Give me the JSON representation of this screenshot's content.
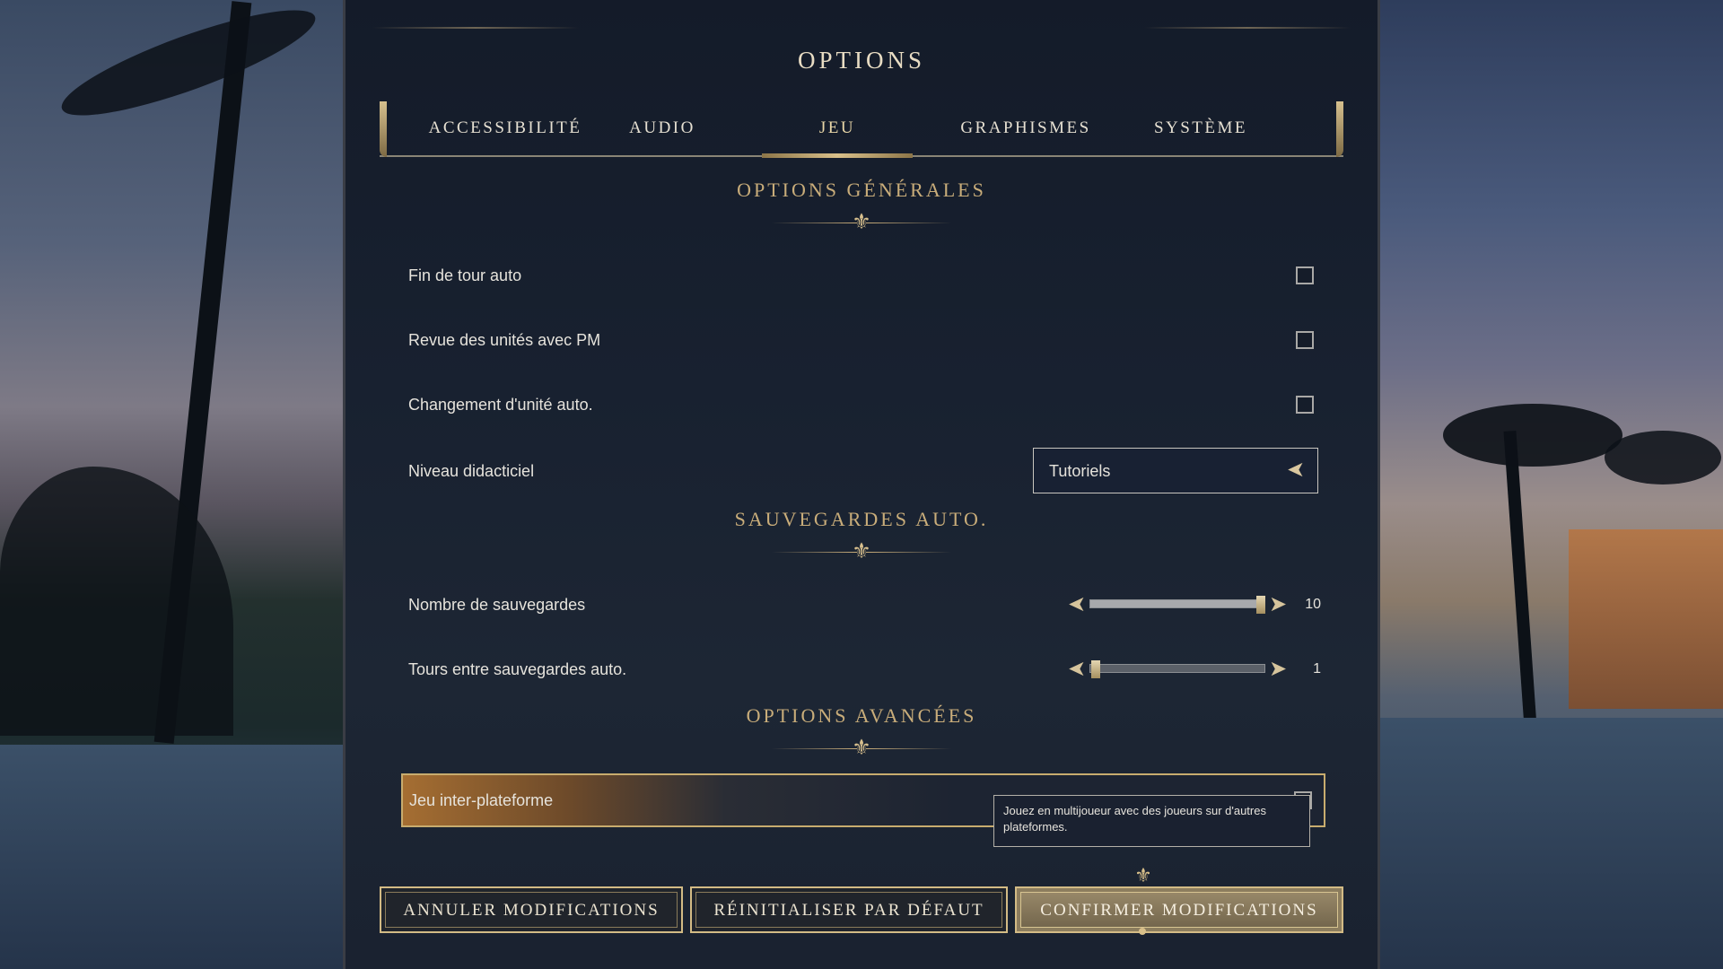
{
  "window": {
    "title": "OPTIONS"
  },
  "tabs": [
    {
      "label": "ACCESSIBILITÉ",
      "active": false
    },
    {
      "label": "AUDIO",
      "active": false
    },
    {
      "label": "JEU",
      "active": true
    },
    {
      "label": "GRAPHISMES",
      "active": false
    },
    {
      "label": "SYSTÈME",
      "active": false
    }
  ],
  "sections": {
    "general": {
      "title": "OPTIONS GÉNÉRALES",
      "rows": [
        {
          "label": "Fin de tour auto",
          "checked": false
        },
        {
          "label": "Revue des unités avec PM",
          "checked": false
        },
        {
          "label": "Changement d'unité auto.",
          "checked": false
        }
      ],
      "tutorial": {
        "label": "Niveau didacticiel",
        "value": "Tutoriels"
      }
    },
    "autosave": {
      "title": "SAUVEGARDES AUTO.",
      "sliders": [
        {
          "label": "Nombre de sauvegardes",
          "value": "10",
          "fraction": 1.0
        },
        {
          "label": "Tours entre sauvegardes auto.",
          "value": "1",
          "fraction": 0.0
        }
      ]
    },
    "advanced": {
      "title": "OPTIONS AVANCÉES",
      "crossplay": {
        "label": "Jeu inter-plateforme",
        "checked": false
      },
      "tooltip": "Jouez en multijoueur avec des joueurs sur d'autres plateformes."
    }
  },
  "buttons": {
    "cancel": "ANNULER MODIFICATIONS",
    "reset": "RÉINITIALISER PAR DÉFAUT",
    "confirm": "CONFIRMER MODIFICATIONS"
  },
  "colors": {
    "accent_gold": "#c9ad7a",
    "panel_bg": "#182130",
    "text": "#e6e3dc"
  }
}
